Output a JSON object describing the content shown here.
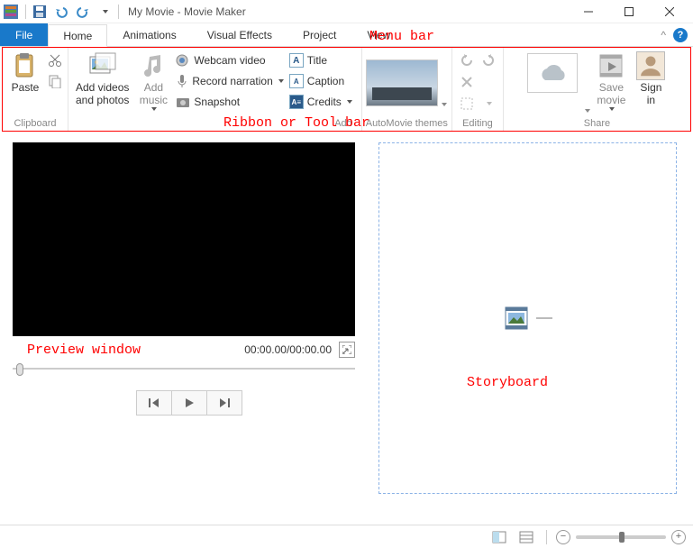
{
  "window": {
    "title": "My Movie - Movie Maker"
  },
  "menubar": {
    "file": "File",
    "home": "Home",
    "animations": "Animations",
    "visual_effects": "Visual Effects",
    "project": "Project",
    "view": "View"
  },
  "ribbon": {
    "clipboard": {
      "label": "Clipboard",
      "paste": "Paste"
    },
    "add": {
      "label": "Add",
      "add_videos": "Add videos\nand photos",
      "add_music": "Add\nmusic",
      "webcam": "Webcam video",
      "record": "Record narration",
      "snapshot": "Snapshot",
      "title": "Title",
      "caption": "Caption",
      "credits": "Credits"
    },
    "automovie": {
      "label": "AutoMovie themes"
    },
    "editing": {
      "label": "Editing"
    },
    "share": {
      "label": "Share",
      "save_movie": "Save\nmovie",
      "sign_in": "Sign\nin"
    }
  },
  "preview": {
    "time": "00:00.00/00:00.00"
  },
  "annotations": {
    "menu_bar": "Menu bar",
    "ribbon": "Ribbon or Tool bar",
    "preview": "Preview window",
    "storyboard": "Storyboard"
  }
}
